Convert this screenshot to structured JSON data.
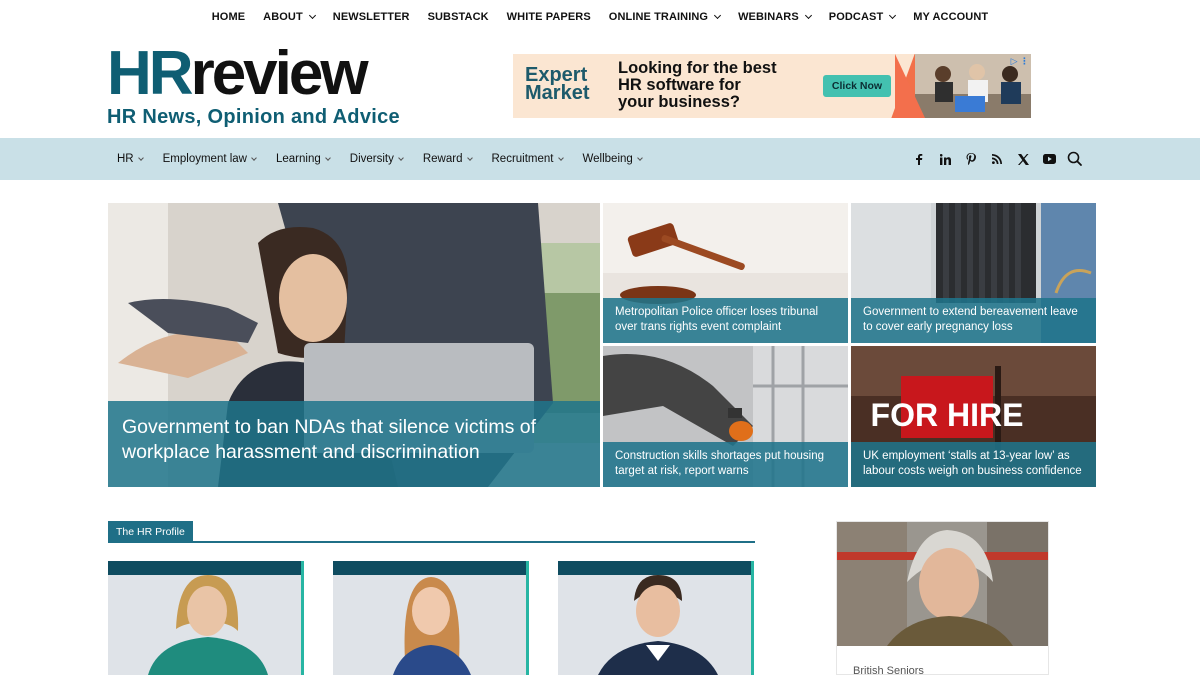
{
  "topnav": [
    {
      "label": "HOME",
      "dropdown": false
    },
    {
      "label": "ABOUT",
      "dropdown": true
    },
    {
      "label": "NEWSLETTER",
      "dropdown": false
    },
    {
      "label": "SUBSTACK",
      "dropdown": false
    },
    {
      "label": "WHITE PAPERS",
      "dropdown": false
    },
    {
      "label": "ONLINE TRAINING",
      "dropdown": true
    },
    {
      "label": "WEBINARS",
      "dropdown": true
    },
    {
      "label": "PODCAST",
      "dropdown": true
    },
    {
      "label": "MY ACCOUNT",
      "dropdown": false
    }
  ],
  "logo": {
    "hr": "HR",
    "review": "review",
    "tagline": "HR News, Opinion and Advice"
  },
  "ad": {
    "brand_line1": "Expert",
    "brand_line2": "Market",
    "headline_line1": "Looking for the best",
    "headline_line2": "HR software for",
    "headline_line3": "your business?",
    "button": "Click Now"
  },
  "catnav": [
    {
      "label": "HR"
    },
    {
      "label": "Employment law"
    },
    {
      "label": "Learning"
    },
    {
      "label": "Diversity"
    },
    {
      "label": "Reward"
    },
    {
      "label": "Recruitment"
    },
    {
      "label": "Wellbeing"
    }
  ],
  "social_icons": [
    "facebook-icon",
    "linkedin-icon",
    "pinterest-icon",
    "rss-icon",
    "x-icon",
    "youtube-icon"
  ],
  "hero": {
    "main": {
      "title": "Government to ban NDAs that silence victims of workplace harassment and discrimination"
    },
    "tiles": [
      {
        "title": "Metropolitan Police officer loses tribunal over trans rights event complaint"
      },
      {
        "title": "Government to extend bereavement leave to cover early pregnancy loss"
      },
      {
        "title": "Construction skills shortages put housing target at risk, report warns"
      },
      {
        "title": "UK employment ‘stalls at 13-year low’ as labour costs weigh on business confidence"
      }
    ],
    "sign_text": "FOR HIRE"
  },
  "profile_section": {
    "heading": "The HR Profile"
  },
  "side_card": {
    "caption": "British Seniors"
  },
  "colors": {
    "brand_teal": "#0f5e73",
    "caption_overlay": "#1f748b",
    "catnav_bg": "#c9e0e7",
    "accent_green": "#27b5a3"
  }
}
